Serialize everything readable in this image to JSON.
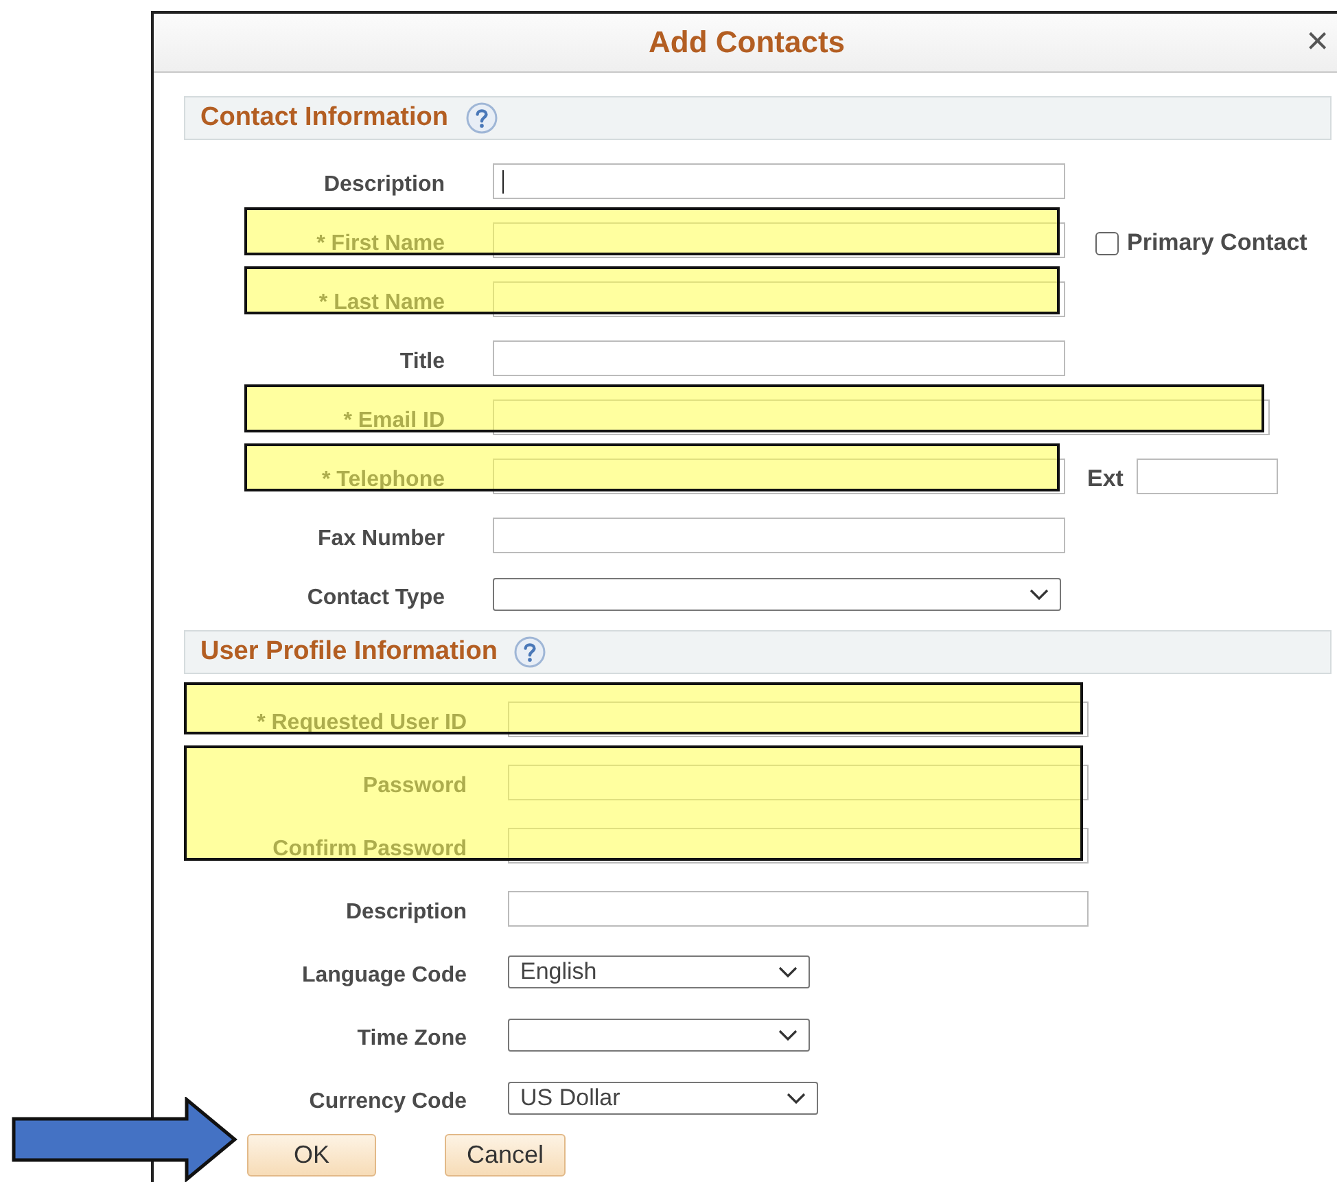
{
  "dialog": {
    "title": "Add Contacts",
    "close": "×"
  },
  "sections": [
    {
      "title": "Contact Information",
      "groups": [
        {
          "highlighted": false,
          "fields": [
            {
              "kind": "text",
              "label": "Description",
              "focused": true
            }
          ]
        },
        {
          "highlighted": true,
          "fields": [
            {
              "kind": "text",
              "label": "* First Name",
              "checkbox": {
                "label": "Primary Contact",
                "checked": false
              }
            }
          ]
        },
        {
          "highlighted": true,
          "fields": [
            {
              "kind": "text",
              "label": "* Last Name"
            }
          ]
        },
        {
          "highlighted": false,
          "fields": [
            {
              "kind": "text",
              "label": "Title"
            }
          ]
        },
        {
          "highlighted": true,
          "fields": [
            {
              "kind": "wide",
              "label": "* Email ID"
            }
          ]
        },
        {
          "highlighted": true,
          "fields": [
            {
              "kind": "text",
              "label": "* Telephone",
              "ext": {
                "label": "Ext"
              }
            }
          ]
        },
        {
          "highlighted": false,
          "fields": [
            {
              "kind": "text",
              "label": "Fax Number"
            }
          ]
        },
        {
          "highlighted": false,
          "fields": [
            {
              "kind": "select",
              "label": "Contact Type"
            }
          ]
        }
      ]
    },
    {
      "title": "User Profile Information",
      "groups": [
        {
          "highlighted": true,
          "fields": [
            {
              "kind": "text",
              "label": "* Requested User ID"
            }
          ]
        },
        {
          "highlighted": true,
          "fields": [
            {
              "kind": "text",
              "label": "Password"
            },
            {
              "kind": "text",
              "label": "Confirm Password"
            }
          ]
        },
        {
          "highlighted": false,
          "fields": [
            {
              "kind": "text",
              "label": "Description"
            }
          ]
        },
        {
          "highlighted": false,
          "fields": [
            {
              "kind": "short-select",
              "label": "Language Code",
              "value": "English"
            }
          ]
        },
        {
          "highlighted": false,
          "fields": [
            {
              "kind": "short-select",
              "label": "Time Zone"
            }
          ]
        },
        {
          "highlighted": false,
          "fields": [
            {
              "kind": "short-select",
              "label": "Currency Code",
              "value": "US Dollar"
            }
          ]
        }
      ]
    }
  ],
  "buttons": [
    {
      "label": "OK"
    },
    {
      "label": "Cancel"
    }
  ]
}
